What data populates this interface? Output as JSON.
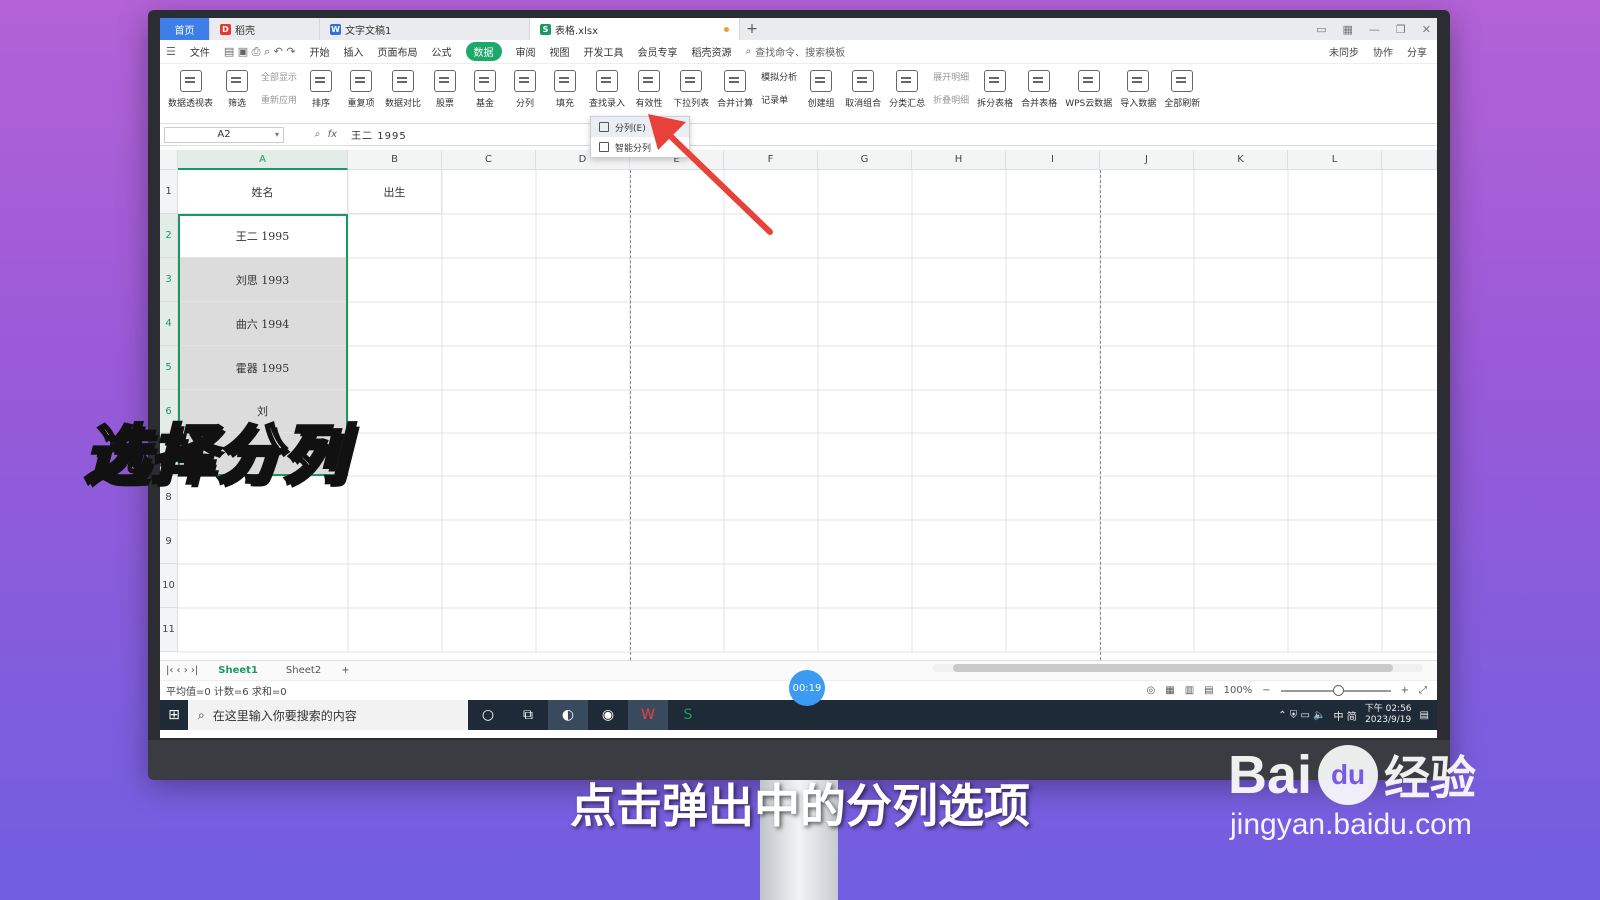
{
  "window": {
    "tabs": [
      {
        "label": "首页",
        "icon": "home-tab-icon"
      },
      {
        "label": "稻壳",
        "icon": "docer-logo-icon"
      },
      {
        "label": "文字文稿1",
        "icon": "writer-logo-icon"
      },
      {
        "label": "表格.xlsx",
        "icon": "sheet-logo-icon"
      }
    ],
    "new_tab": "+"
  },
  "menubar": {
    "file_label": "文件",
    "items": [
      "开始",
      "插入",
      "页面布局",
      "公式",
      "数据",
      "审阅",
      "视图",
      "开发工具",
      "会员专享",
      "稻壳资源"
    ],
    "active_item": "数据",
    "search_placeholder": "查找命令、搜索模板",
    "right": [
      "未同步",
      "协作",
      "分享"
    ]
  },
  "ribbon": {
    "buttons": [
      "数据透视表",
      "筛选",
      "排序",
      "重复项",
      "数据对比",
      "股票",
      "基金",
      "分列",
      "填充",
      "查找录入",
      "有效性",
      "下拉列表",
      "合并计算",
      "创建组",
      "取消组合",
      "分类汇总",
      "拆分表格",
      "合并表格",
      "WPS云数据",
      "导入数据",
      "全部刷新"
    ],
    "small_filter": [
      "全部显示",
      "重新应用"
    ],
    "small_sim": [
      "模拟分析",
      "记录单"
    ],
    "small_detail": [
      "展开明细",
      "折叠明细"
    ]
  },
  "dropdown": {
    "items": [
      "分列(E)",
      "智能分列"
    ]
  },
  "formula_bar": {
    "name_box": "A2",
    "fx_label": "fx",
    "value": "王二   1995"
  },
  "columns": [
    "A",
    "B",
    "C",
    "D",
    "E",
    "F",
    "G",
    "H",
    "I",
    "J",
    "K",
    "L"
  ],
  "rows": [
    "1",
    "2",
    "3",
    "4",
    "5",
    "6",
    "7",
    "8",
    "9",
    "10",
    "11"
  ],
  "cells": {
    "a1": "姓名",
    "b1": "出生",
    "a2": "王二   1995",
    "a3": "刘思   1993",
    "a4": "曲六   1994",
    "a5": "霍器   1995",
    "a6": "刘"
  },
  "sheets": {
    "tabs": [
      "Sheet1",
      "Sheet2"
    ],
    "active": "Sheet1",
    "add": "+"
  },
  "status": {
    "summary": "平均值=0  计数=6  求和=0",
    "zoom": "100%"
  },
  "taskbar": {
    "search_placeholder": "在这里输入你要搜索的内容",
    "tray_text": "中 简",
    "clock_time": "下午 02:56",
    "clock_date": "2023/9/19"
  },
  "video": {
    "timer": "00:19",
    "overlay_title": "选择分列",
    "subtitle": "点击弹出中的分列选项"
  },
  "watermark": {
    "brand_latin": "Bai",
    "brand_du": "du",
    "brand_cn": "经验",
    "url": "jingyan.baidu.com"
  },
  "colors": {
    "accent_green": "#1a9a62",
    "tab_blue": "#3d7ee8",
    "arrow_red": "#e8413a",
    "timer_blue": "#3a9bf0"
  }
}
